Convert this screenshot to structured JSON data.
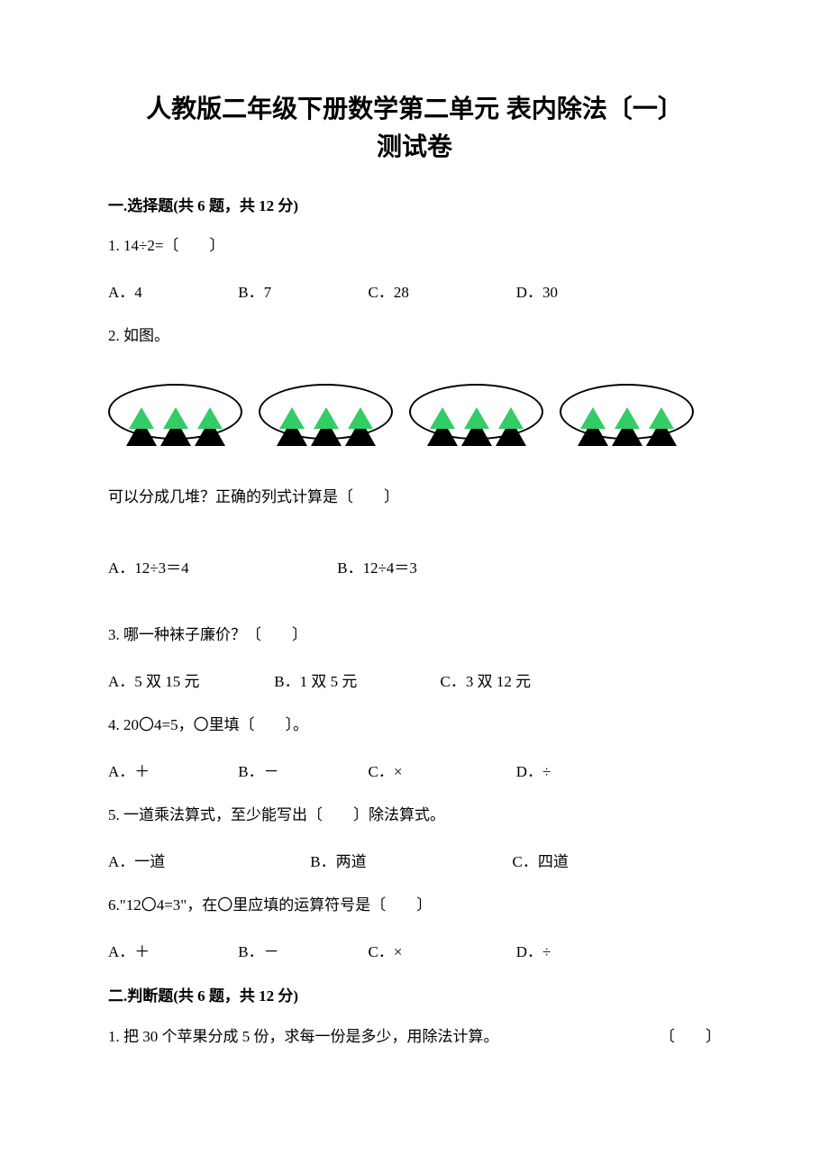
{
  "title_line1": "人教版二年级下册数学第二单元 表内除法〔一〕",
  "title_line2": "测试卷",
  "sections": {
    "s1_header": "一.选择题(共 6 题，共 12 分)",
    "s2_header": "二.判断题(共 6 题，共 12 分)"
  },
  "q1": {
    "text": "1. 14÷2=〔　　〕",
    "A": "A．4",
    "B": "B．7",
    "C": "C．28",
    "D": "D．30"
  },
  "q2": {
    "intro": "2. 如图。",
    "text": "可以分成几堆？正确的列式计算是〔　　〕",
    "A": "A．12÷3＝4",
    "B": "B．12÷4＝3"
  },
  "q3": {
    "text": "3. 哪一种袜子廉价？〔　　〕",
    "A": "A．5 双 15 元",
    "B": "B．1 双 5 元",
    "C": "C．3 双 12 元"
  },
  "q4": {
    "text": "4. 20〇4=5，〇里填〔　　〕。",
    "A": "A．＋",
    "B": "B．－",
    "C": "C．×",
    "D": "D．÷"
  },
  "q5": {
    "text": "5. 一道乘法算式，至少能写出〔　　〕除法算式。",
    "A": "A．一道",
    "B": "B．两道",
    "C": "C．四道"
  },
  "q6": {
    "text": "6.\"12〇4=3\"，在〇里应填的运算符号是〔　　〕",
    "A": "A．＋",
    "B": "B．－",
    "C": "C．×",
    "D": "D．÷"
  },
  "j1": {
    "text": "1. 把 30 个苹果分成 5 份，求每一份是多少，用除法计算。",
    "blank": "〔　　〕"
  }
}
